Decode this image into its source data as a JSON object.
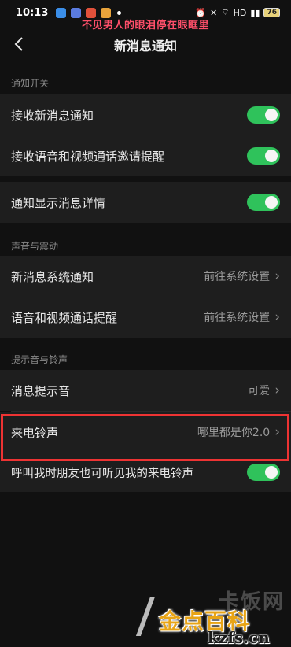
{
  "status_bar": {
    "time": "10:13",
    "battery": "76",
    "signal_text": "HD"
  },
  "overlay_caption": "不见男人的眼泪停在眼眶里",
  "nav": {
    "back_icon": "chevron-left-icon",
    "title": "新消息通知"
  },
  "sections": {
    "notify_switch": {
      "header": "通知开关"
    },
    "sound_vibrate": {
      "header": "声音与震动"
    },
    "tone_ringtone": {
      "header": "提示音与铃声"
    }
  },
  "rows": {
    "receive_new_msg": {
      "label": "接收新消息通知",
      "toggle_on": true
    },
    "receive_call_invite": {
      "label": "接收语音和视频通话邀请提醒",
      "toggle_on": true
    },
    "show_details": {
      "label": "通知显示消息详情",
      "toggle_on": true
    },
    "new_msg_system": {
      "label": "新消息系统通知",
      "value": "前往系统设置"
    },
    "call_reminder": {
      "label": "语音和视频通话提醒",
      "value": "前往系统设置"
    },
    "msg_tone": {
      "label": "消息提示音",
      "value": "可爱"
    },
    "ringtone": {
      "label": "来电铃声",
      "value": "哪里都是你2.0"
    },
    "friends_hear": {
      "label": "呼叫我时朋友也可听见我的来电铃声",
      "toggle_on": true
    }
  },
  "colors": {
    "toggle_on": "#2fc25b",
    "highlight": "#ee3333",
    "background": "#111111",
    "row_bg": "#1e1e1e"
  },
  "watermark": {
    "brand": "金点百科",
    "url": "kzfs.cn",
    "faded": "卡饭网"
  }
}
